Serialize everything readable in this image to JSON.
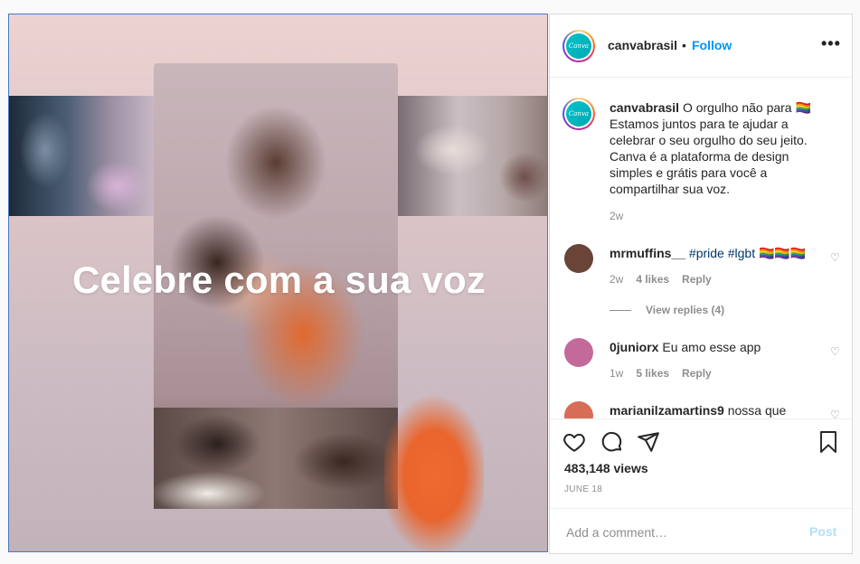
{
  "media": {
    "overlay_text": "Celebre com a sua voz"
  },
  "header": {
    "username": "canvabrasil",
    "separator": "•",
    "follow_label": "Follow",
    "more_label": "•••",
    "logo_text": "Canva"
  },
  "caption": {
    "username": "canvabrasil",
    "text": "O orgulho não para 🏳️‍🌈 Estamos juntos para te ajudar a celebrar o seu orgulho do seu jeito. Canva é a plataforma de design simples e grátis para você a compartilhar sua voz.",
    "time": "2w"
  },
  "comments": [
    {
      "username": "mrmuffins__",
      "text": "#pride #lgbt 🏳️‍🌈🏳️‍🌈🏳️‍🌈",
      "time": "2w",
      "likes": "4 likes",
      "reply_label": "Reply",
      "avatar_color": "#6b4438"
    },
    {
      "username": "0juniorx",
      "text": "Eu amo esse app",
      "time": "1w",
      "likes": "5 likes",
      "reply_label": "Reply",
      "avatar_color": "#c46a9a"
    },
    {
      "username": "marianilzamartins9",
      "text": "nossa que",
      "avatar_color": "#d86d57"
    }
  ],
  "view_replies_label": "View replies (4)",
  "icons": {
    "like": "heart-icon",
    "comment": "comment-icon",
    "share": "share-icon",
    "save": "bookmark-icon"
  },
  "stats": {
    "views": "483,148 views",
    "date": "JUNE 18"
  },
  "add_comment": {
    "placeholder": "Add a comment…",
    "post_label": "Post"
  },
  "colors": {
    "link_blue": "#0095f6",
    "post_disabled": "#b2dffc",
    "hashtag": "#00376b",
    "canva_teal": "#00c4cc"
  }
}
